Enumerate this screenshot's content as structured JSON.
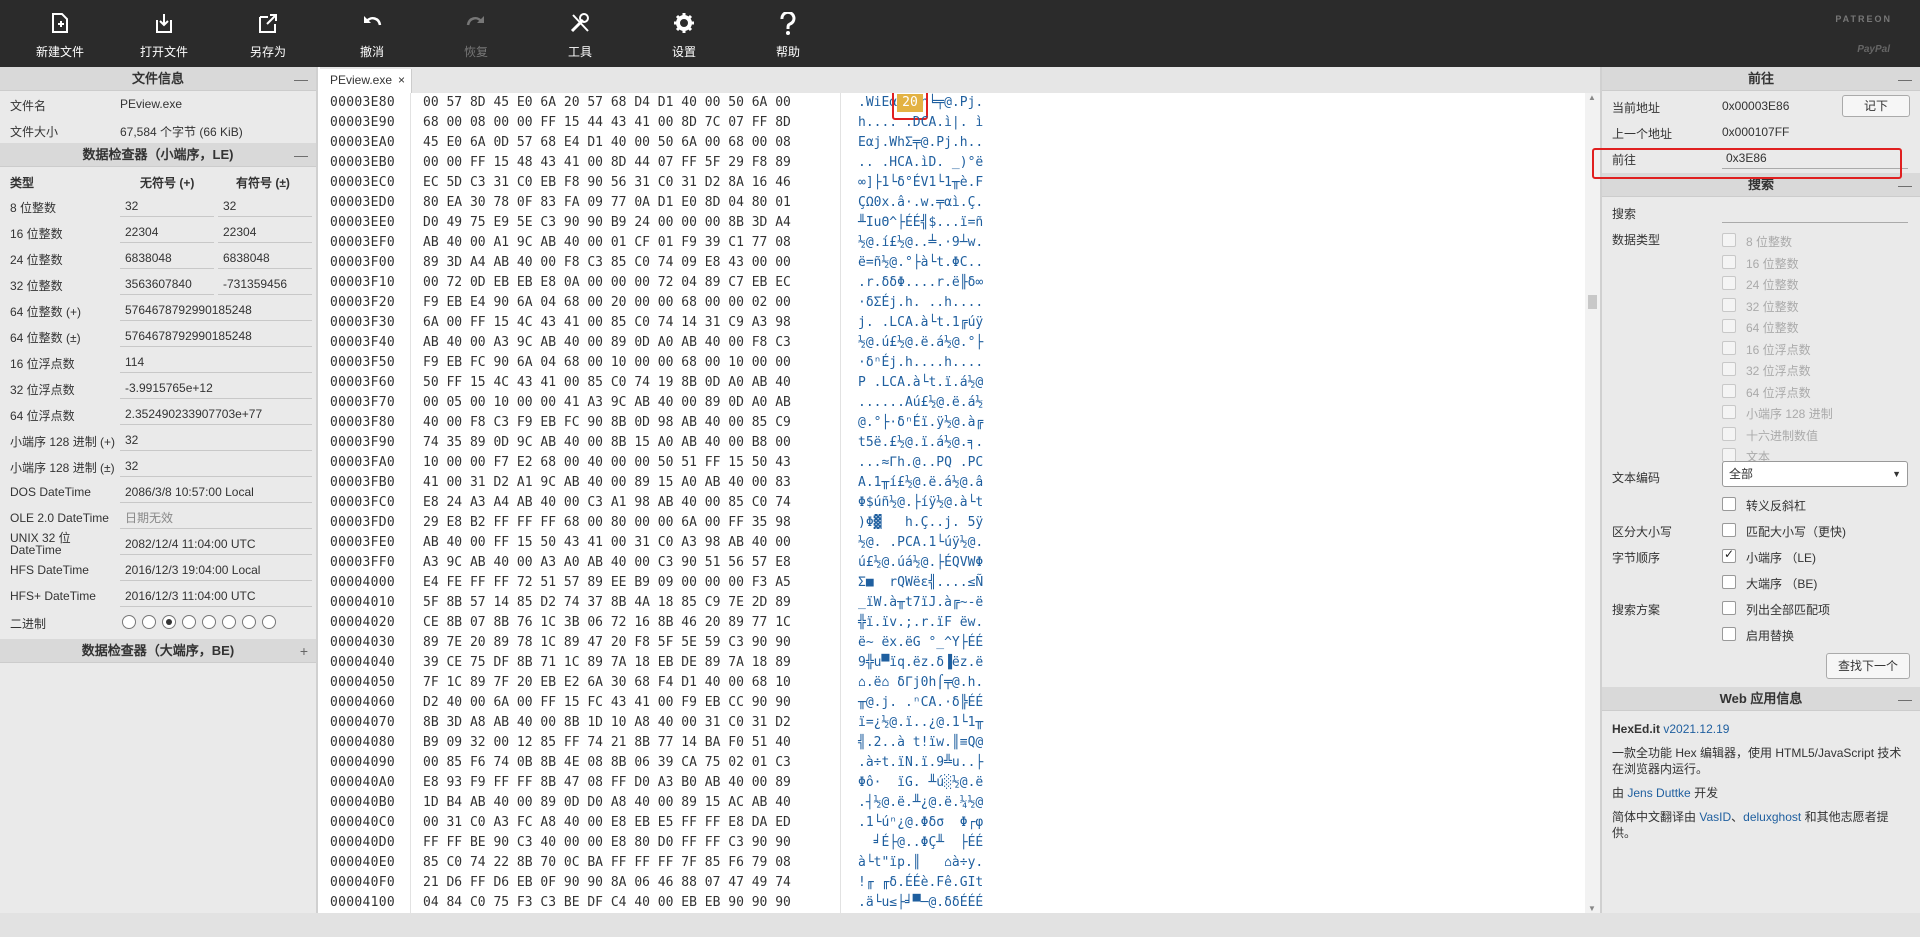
{
  "toolbar": {
    "new_file": "新建文件",
    "open_file": "打开文件",
    "save_as": "另存为",
    "undo": "撤消",
    "redo": "恢复",
    "tools": "工具",
    "settings": "设置",
    "help": "帮助",
    "brand_top": "PATREON",
    "brand_bottom": "PayPal"
  },
  "file_info": {
    "title": "文件信息",
    "name_label": "文件名",
    "name_value": "PEview.exe",
    "size_label": "文件大小",
    "size_value": "67,584 个字节 (66 KiB)"
  },
  "inspector_le": {
    "title": "数据检查器（小端序，LE)",
    "col_type": "类型",
    "col_unsigned": "无符号 (+)",
    "col_signed": "有符号 (±)",
    "rows": [
      {
        "label": "8 位整数",
        "u": "32",
        "s": "32"
      },
      {
        "label": "16 位整数",
        "u": "22304",
        "s": "22304"
      },
      {
        "label": "24 位整数",
        "u": "6838048",
        "s": "6838048"
      },
      {
        "label": "32 位整数",
        "u": "3563607840",
        "s": "-731359456"
      }
    ],
    "wide_rows": [
      {
        "label": "64 位整数 (+)",
        "v": "5764678792990185248"
      },
      {
        "label": "64 位整数 (±)",
        "v": "5764678792990185248"
      },
      {
        "label": "16 位浮点数",
        "v": "114"
      },
      {
        "label": "32 位浮点数",
        "v": "-3.9915765e+12"
      },
      {
        "label": "64 位浮点数",
        "v": "2.352490233907703e+77"
      },
      {
        "label": "小端序 128 进制 (+)",
        "v": "32"
      },
      {
        "label": "小端序 128 进制 (±)",
        "v": "32"
      },
      {
        "label": "DOS DateTime",
        "v": "2086/3/8 10:57:00 Local"
      },
      {
        "label": "OLE 2.0 DateTime",
        "v": "日期无效"
      },
      {
        "label": "UNIX 32 位 DateTime",
        "v": "2082/12/4 11:04:00 UTC"
      },
      {
        "label": "HFS DateTime",
        "v": "2016/12/3 19:04:00 Local"
      },
      {
        "label": "HFS+ DateTime",
        "v": "2016/12/3 11:04:00 UTC"
      }
    ],
    "binary_label": "二进制",
    "binary_bits": [
      0,
      0,
      1,
      0,
      0,
      0,
      0,
      0
    ]
  },
  "inspector_be": {
    "title": "数据检查器（大端序，BE)"
  },
  "tab": {
    "filename": "PEview.exe",
    "close": "×"
  },
  "hex_rows": [
    {
      "a": "00003E80",
      "b": "00 57 8D 45 E0 6A 20 57 68 D4 D1 40 00 50 6A 00",
      "t": ".WiEαj Wh╘╤@.Pj."
    },
    {
      "a": "00003E90",
      "b": "68 00 08 00 00 FF 15 44 43 41 00 8D 7C 07 FF 8D",
      "t": "h.... .DCA.ì|. ì"
    },
    {
      "a": "00003EA0",
      "b": "45 E0 6A 0D 57 68 E4 D1 40 00 50 6A 00 68 00 08",
      "t": "Eαj.WhΣ╤@.Pj.h.."
    },
    {
      "a": "00003EB0",
      "b": "00 00 FF 15 48 43 41 00 8D 44 07 FF 5F 29 F8 89",
      "t": ".. .HCA.ìD. _)°ë"
    },
    {
      "a": "00003EC0",
      "b": "EC 5D C3 31 C0 EB F8 90 56 31 C0 31 D2 8A 16 46",
      "t": "∞]├1└δ°ÉV1└1╥è.F"
    },
    {
      "a": "00003ED0",
      "b": "80 EA 30 78 0F 83 FA 09 77 0A D1 E0 8D 04 80 01",
      "t": "ÇΩ0x.â·.w.╤αì.Ç."
    },
    {
      "a": "00003EE0",
      "b": "D0 49 75 E9 5E C3 90 90 B9 24 00 00 00 8B 3D A4",
      "t": "╨IuΘ^├ÉÉ╣$...ï=ñ"
    },
    {
      "a": "00003EF0",
      "b": "AB 40 00 A1 9C AB 40 00 01 CF 01 F9 39 C1 77 08",
      "t": "½@.í£½@..╧.·9┴w."
    },
    {
      "a": "00003F00",
      "b": "89 3D A4 AB 40 00 F8 C3 85 C0 74 09 E8 43 00 00",
      "t": "ë=ñ½@.°├à└t.ΦC.."
    },
    {
      "a": "00003F10",
      "b": "00 72 0D EB EB E8 0A 00 00 00 72 04 89 C7 EB EC",
      "t": ".r.δδΦ....r.ë╟δ∞"
    },
    {
      "a": "00003F20",
      "b": "F9 EB E4 90 6A 04 68 00 20 00 00 68 00 00 02 00",
      "t": "·δΣÉj.h. ..h...."
    },
    {
      "a": "00003F30",
      "b": "6A 00 FF 15 4C 43 41 00 85 C0 74 14 31 C9 A3 98",
      "t": "j. .LCA.à└t.1╔úÿ"
    },
    {
      "a": "00003F40",
      "b": "AB 40 00 A3 9C AB 40 00 89 0D A0 AB 40 00 F8 C3",
      "t": "½@.ú£½@.ë.á½@.°├"
    },
    {
      "a": "00003F50",
      "b": "F9 EB FC 90 6A 04 68 00 10 00 00 68 00 10 00 00",
      "t": "·δⁿÉj.h....h...."
    },
    {
      "a": "00003F60",
      "b": "50 FF 15 4C 43 41 00 85 C0 74 19 8B 0D A0 AB 40",
      "t": "P .LCA.à└t.ï.á½@"
    },
    {
      "a": "00003F70",
      "b": "00 05 00 10 00 00 41 A3 9C AB 40 00 89 0D A0 AB",
      "t": "......Aú£½@.ë.á½"
    },
    {
      "a": "00003F80",
      "b": "40 00 F8 C3 F9 EB FC 90 8B 0D 98 AB 40 00 85 C9",
      "t": "@.°├·δⁿÉï.ÿ½@.à╔"
    },
    {
      "a": "00003F90",
      "b": "74 35 89 0D 9C AB 40 00 8B 15 A0 AB 40 00 B8 00",
      "t": "t5ë.£½@.ï.á½@.╕."
    },
    {
      "a": "00003FA0",
      "b": "10 00 00 F7 E2 68 00 40 00 00 50 51 FF 15 50 43",
      "t": "...≈Γh.@..PQ .PC"
    },
    {
      "a": "00003FB0",
      "b": "41 00 31 D2 A1 9C AB 40 00 89 15 A0 AB 40 00 83",
      "t": "A.1╥í£½@.ë.á½@.â"
    },
    {
      "a": "00003FC0",
      "b": "E8 24 A3 A4 AB 40 00 C3 A1 98 AB 40 00 85 C0 74",
      "t": "Φ$úñ½@.├íÿ½@.à└t"
    },
    {
      "a": "00003FD0",
      "b": "29 E8 B2 FF FF FF 68 00 80 00 00 6A 00 FF 35 98",
      "t": ")Φ▓   h.Ç..j. 5ÿ"
    },
    {
      "a": "00003FE0",
      "b": "AB 40 00 FF 15 50 43 41 00 31 C0 A3 98 AB 40 00",
      "t": "½@. .PCA.1└úÿ½@."
    },
    {
      "a": "00003FF0",
      "b": "A3 9C AB 40 00 A3 A0 AB 40 00 C3 90 51 56 57 E8",
      "t": "ú£½@.úá½@.├ÉQVWΦ"
    },
    {
      "a": "00004000",
      "b": "E4 FE FF FF 72 51 57 89 EE B9 09 00 00 00 F3 A5",
      "t": "Σ■  rQWëε╣....≤Ñ"
    },
    {
      "a": "00004010",
      "b": "5F 8B 57 14 85 D2 74 37 8B 4A 18 85 C9 7E 2D 89",
      "t": "_ïW.à╥t7ïJ.à╔~-ë"
    },
    {
      "a": "00004020",
      "b": "CE 8B 07 8B 76 1C 3B 06 72 16 8B 46 20 89 77 1C",
      "t": "╬ï.ïv.;.r.ïF ëw."
    },
    {
      "a": "00004030",
      "b": "89 7E 20 89 78 1C 89 47 20 F8 5F 5E 59 C3 90 90",
      "t": "ë~ ëx.ëG °_^Y├ÉÉ"
    },
    {
      "a": "00004040",
      "b": "39 CE 75 DF 8B 71 1C 89 7A 18 EB DE 89 7A 18 89",
      "t": "9╬u▀ïq.ëz.δ▐ëz.ë"
    },
    {
      "a": "00004050",
      "b": "7F 1C 89 7F 20 EB E2 6A 30 68 F4 D1 40 00 68 10",
      "t": "⌂.ë⌂ δΓj0h⌠╤@.h."
    },
    {
      "a": "00004060",
      "b": "D2 40 00 6A 00 FF 15 FC 43 41 00 F9 EB CC 90 90",
      "t": "╥@.j. .ⁿCA.·δ╠ÉÉ"
    },
    {
      "a": "00004070",
      "b": "8B 3D A8 AB 40 00 8B 1D 10 A8 40 00 31 C0 31 D2",
      "t": "ï=¿½@.ï..¿@.1└1╥"
    },
    {
      "a": "00004080",
      "b": "B9 09 32 00 12 85 FF 74 21 8B 77 14 BA F0 51 40",
      "t": "╣.2..à t!ïw.║≡Q@"
    },
    {
      "a": "00004090",
      "b": "00 85 F6 74 0B 8B 4E 08 8B 06 39 CA 75 02 01 C3",
      "t": ".à÷t.ïN.ï.9╩u..├"
    },
    {
      "a": "000040A0",
      "b": "E8 93 F9 FF FF 8B 47 08 FF D0 A3 B0 AB 40 00 89",
      "t": "Φô·  ïG. ╨ú░½@.ë"
    },
    {
      "a": "000040B0",
      "b": "1D B4 AB 40 00 89 0D D0 A8 40 00 89 15 AC AB 40",
      "t": ".┤½@.ë.╨¿@.ë.¼½@"
    },
    {
      "a": "000040C0",
      "b": "00 31 C0 A3 FC A8 40 00 E8 EB E5 FF FF E8 DA ED",
      "t": ".1└úⁿ¿@.Φδσ  Φ┌φ"
    },
    {
      "a": "000040D0",
      "b": "FF FF BE 90 C3 40 00 00 E8 80 D0 FF FF C3 90 90",
      "t": "  ╛É├@..ΦÇ╨  ├ÉÉ"
    },
    {
      "a": "000040E0",
      "b": "85 C0 74 22 8B 70 0C BA FF FF FF 7F 85 F6 79 08",
      "t": "à└t\"ïp.║   ⌂à÷y."
    },
    {
      "a": "000040F0",
      "b": "21 D6 FF D6 EB 0F 90 90 8A 06 46 88 07 47 49 74",
      "t": "!╓ ╓δ.ÉÉè.Fê.GIt"
    },
    {
      "a": "00004100",
      "b": "04 84 C0 75 F3 C3 BE DF C4 40 00 EB EB 90 90 90",
      "t": ".ä└u≤├╛▀─@.δδÉÉÉ"
    }
  ],
  "goto": {
    "title": "前往",
    "cur_label": "当前地址",
    "cur_value": "0x00003E86",
    "remember_btn": "记下",
    "prev_label": "上一个地址",
    "prev_value": "0x000107FF",
    "goto_label": "前往",
    "goto_value": "0x3E86"
  },
  "search": {
    "title": "搜索",
    "search_label": "搜索",
    "search_value": "",
    "type_label": "数据类型",
    "types": [
      "8 位整数",
      "16 位整数",
      "24 位整数",
      "32 位整数",
      "64 位整数",
      "16 位浮点数",
      "32 位浮点数",
      "64 位浮点数",
      "小端序 128 进制",
      "十六进制数值",
      "文本"
    ],
    "encoding_label": "文本编码",
    "encoding_value": "全部",
    "escape_label": "转义反斜杠",
    "case_label": "区分大小写",
    "case_option": "匹配大小写（更快)",
    "byte_order_label": "字节顺序",
    "le_option": "小端序 （LE)",
    "be_option": "大端序 （BE)",
    "strategy_label": "搜索方案",
    "list_all": "列出全部匹配项",
    "enable_replace": "启用替换",
    "find_next": "查找下一个"
  },
  "about": {
    "title": "Web 应用信息",
    "app_name": "HexEd.it",
    "version": "v2021.12.19",
    "desc": "一款全功能 Hex 编辑器，使用 HTML5/JavaScript 技术在浏览器内运行。",
    "by_prefix": "由",
    "author": "Jens Duttke",
    "by_suffix": "开发",
    "trans_prefix": "简体中文翻译由",
    "translator1": "VasID",
    "comma": "、",
    "translator2": "deluxghost",
    "trans_suffix": "和其他志愿者提供。"
  },
  "colors": {
    "toolbar_bg": "#2b2b2b",
    "highlight": "#e3b243",
    "annotation": "#e02020",
    "ascii": "#1f5f9f"
  }
}
